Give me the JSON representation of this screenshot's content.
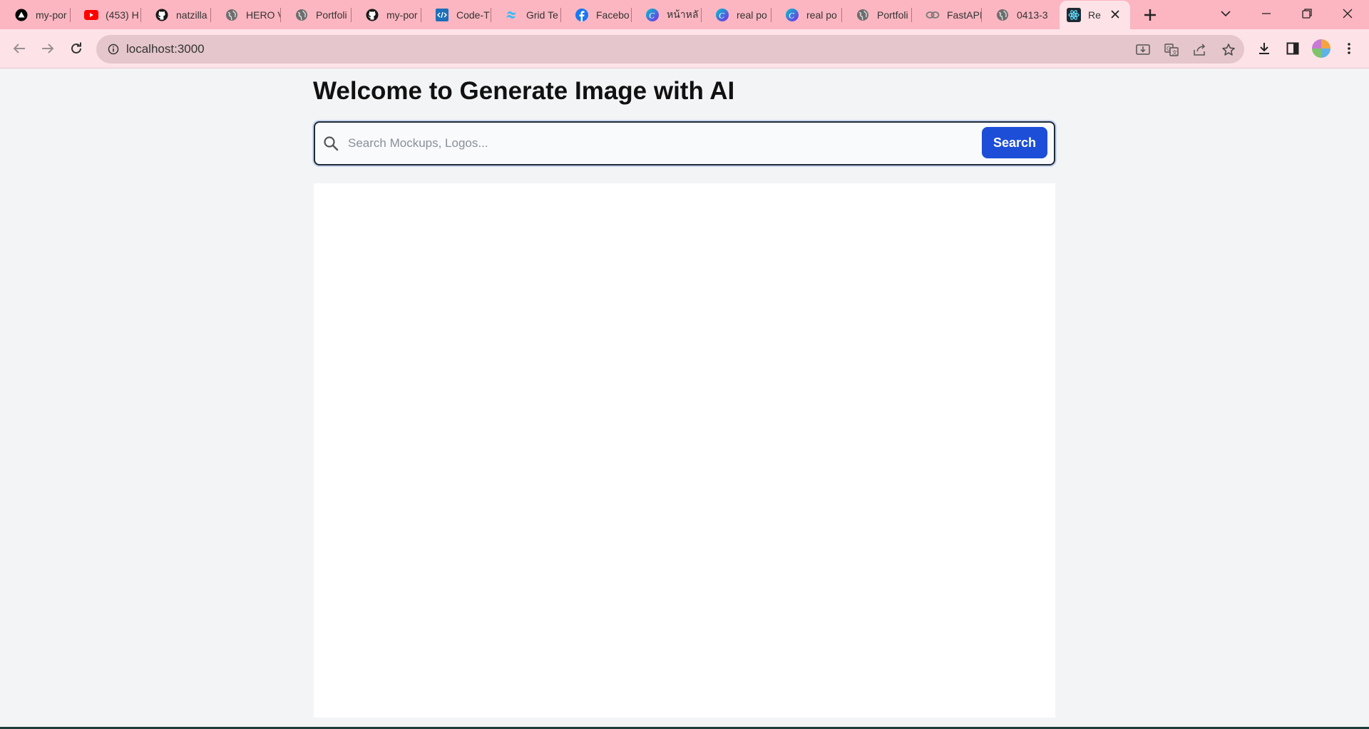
{
  "browser": {
    "tabs": [
      {
        "title": "my-por",
        "icon": "vercel-icon"
      },
      {
        "title": "(453) H",
        "icon": "youtube-icon"
      },
      {
        "title": "natzilla",
        "icon": "github-icon"
      },
      {
        "title": "HERO V",
        "icon": "globe-icon"
      },
      {
        "title": "Portfoli",
        "icon": "globe-icon"
      },
      {
        "title": "my-por",
        "icon": "github-icon"
      },
      {
        "title": "Code-T",
        "icon": "code-icon"
      },
      {
        "title": "Grid Te",
        "icon": "tailwind-icon"
      },
      {
        "title": "Facebo",
        "icon": "facebook-icon"
      },
      {
        "title": "หน้าหลั",
        "icon": "canva-icon"
      },
      {
        "title": "real po",
        "icon": "canva-icon"
      },
      {
        "title": "real po",
        "icon": "canva-icon"
      },
      {
        "title": "Portfoli",
        "icon": "globe-icon"
      },
      {
        "title": "FastAPI",
        "icon": "link-icon"
      },
      {
        "title": "0413-3",
        "icon": "globe-icon"
      }
    ],
    "active_tab": {
      "title": "Re",
      "icon": "react-icon"
    },
    "url": "localhost:3000"
  },
  "page": {
    "heading": "Welcome to Generate Image with AI",
    "search": {
      "placeholder": "Search Mockups, Logos...",
      "value": "",
      "button_label": "Search"
    }
  },
  "colors": {
    "tabstrip_bg": "#fbb6c1",
    "toolbar_bg": "#fde3e8",
    "page_bg": "#f3f4f6",
    "button_accent": "#1d4ed8"
  }
}
